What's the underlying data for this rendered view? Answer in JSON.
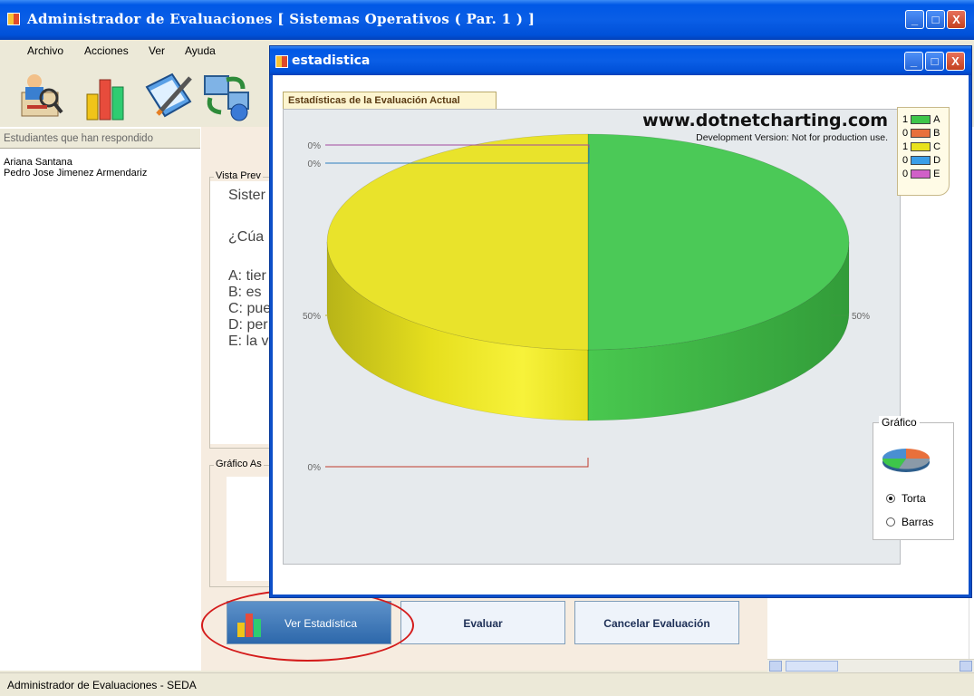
{
  "main_window": {
    "title": "Administrador de Evaluaciones [ Sistemas Operativos ( Par. 1 ) ]",
    "caption_buttons": {
      "minimize": "_",
      "maximize": "□",
      "close": "X"
    }
  },
  "menu": [
    "Archivo",
    "Acciones",
    "Ver",
    "Ayuda"
  ],
  "toolbar": {
    "icons": [
      "students-search-icon",
      "bar-chart-icon",
      "book-pen-icon",
      "network-globe-icon"
    ]
  },
  "left_panel": {
    "header": "Estudiantes que han respondido",
    "students": [
      "Ariana Santana",
      "Pedro Jose Jimenez Armendariz"
    ]
  },
  "preview": {
    "group_title": "Vista Prev",
    "lines": [
      "Sister",
      "¿Cúa",
      "A: tier",
      "B: es",
      "C: pue",
      "D: per",
      "E: la v"
    ]
  },
  "chart_group_title": "Gráfico As",
  "buttons": {
    "ver_estadistica": "Ver Estadística",
    "evaluar": "Evaluar",
    "cancelar": "Cancelar Evaluación"
  },
  "statusbar": "Administrador de Evaluaciones - SEDA",
  "dialog": {
    "title": "estadistica",
    "chart_tab": "Estadísticas de la Evaluación Actual",
    "watermark_title": "www.dotnetcharting.com",
    "watermark_sub": "Development Version: Not for production use.",
    "graph_group_title": "Gráfico",
    "graph_options": [
      {
        "label": "Torta",
        "selected": true
      },
      {
        "label": "Barras",
        "selected": false
      }
    ]
  },
  "colors": {
    "A": "#3ec64a",
    "B": "#e8703c",
    "C": "#e9e21a",
    "D": "#3a9ee8",
    "E": "#d060c8"
  },
  "chart_data": {
    "type": "pie",
    "categories": [
      "A",
      "B",
      "C",
      "D",
      "E"
    ],
    "values": [
      1,
      0,
      1,
      0,
      0
    ],
    "slice_labels": {
      "A": "50%",
      "B": "0%",
      "C": "50%",
      "D": "0%",
      "E": "0%"
    },
    "legend_position": "top-right",
    "title": ""
  }
}
